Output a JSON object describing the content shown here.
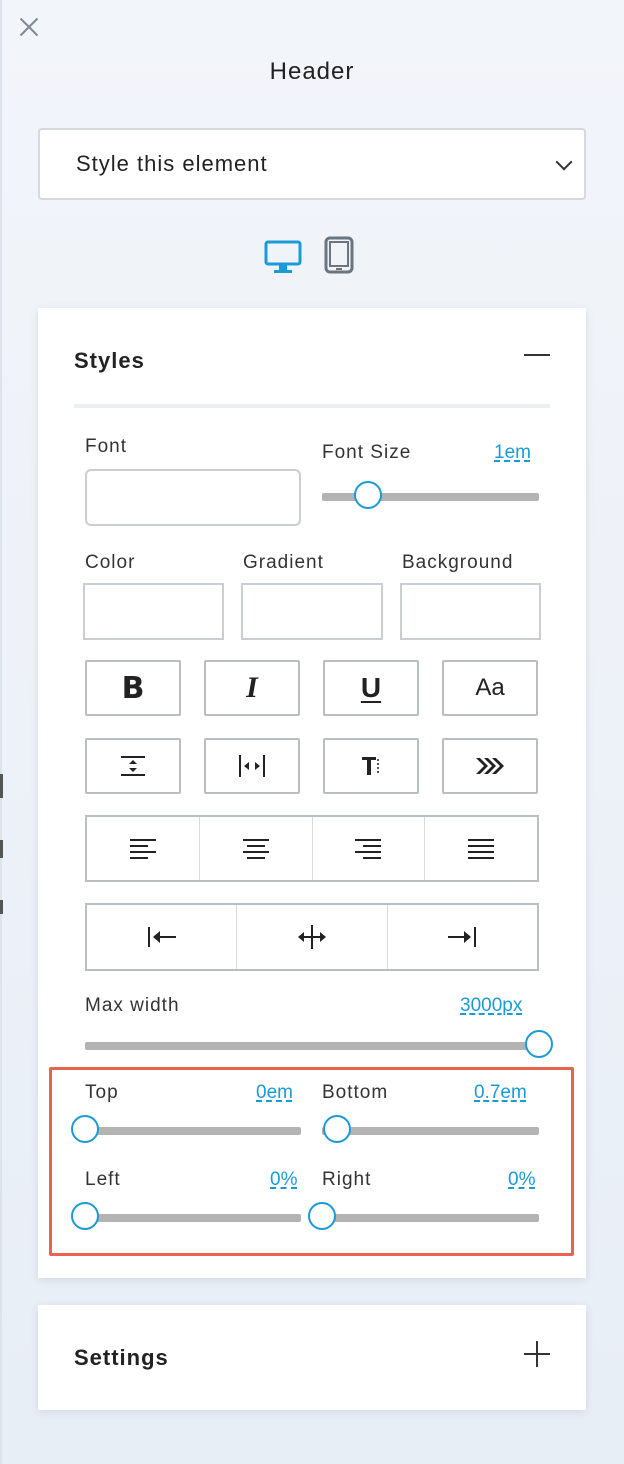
{
  "panel": {
    "title": "Header",
    "close_icon": "close-icon",
    "style_select": {
      "selected": "Style this element"
    },
    "devices": [
      {
        "name": "desktop",
        "icon": "desktop-icon",
        "active": true,
        "color": "#1a9bd7"
      },
      {
        "name": "tablet",
        "icon": "tablet-icon",
        "active": false,
        "color": "#6b7580"
      }
    ]
  },
  "styles": {
    "title": "Styles",
    "font": {
      "label": "Font",
      "value": ""
    },
    "font_size": {
      "label": "Font Size",
      "value": "1em",
      "slider_fraction": 0.21
    },
    "color": {
      "label": "Color",
      "value": ""
    },
    "gradient": {
      "label": "Gradient",
      "value": ""
    },
    "background": {
      "label": "Background",
      "value": ""
    },
    "text_format_buttons": [
      {
        "name": "bold",
        "glyph": "B"
      },
      {
        "name": "italic",
        "glyph": "I"
      },
      {
        "name": "underline",
        "glyph": "U"
      },
      {
        "name": "case",
        "glyph": "Aa"
      }
    ],
    "spacing_buttons": [
      {
        "name": "line-height",
        "icon": "line-height-icon"
      },
      {
        "name": "letter-spacing",
        "icon": "letter-spacing-icon"
      },
      {
        "name": "text-style",
        "icon": "text-style-icon"
      },
      {
        "name": "text-effects",
        "icon": "double-chevron-right-icon"
      }
    ],
    "align_buttons": [
      "align-left",
      "align-center",
      "align-right",
      "align-justify"
    ],
    "position_buttons": [
      "position-left",
      "position-center",
      "position-right"
    ],
    "max_width": {
      "label": "Max width",
      "value": "3000px",
      "slider_fraction": 1.0
    },
    "margins": {
      "top": {
        "label": "Top",
        "value": "0em",
        "slider_fraction": 0.0
      },
      "bottom": {
        "label": "Bottom",
        "value": "0.7em",
        "slider_fraction": 0.07
      },
      "left": {
        "label": "Left",
        "value": "0%",
        "slider_fraction": 0.0
      },
      "right": {
        "label": "Right",
        "value": "0%",
        "slider_fraction": 0.0
      }
    }
  },
  "settings": {
    "title": "Settings"
  },
  "colors": {
    "accent": "#1a9bd7",
    "highlight": "#e8644f"
  }
}
